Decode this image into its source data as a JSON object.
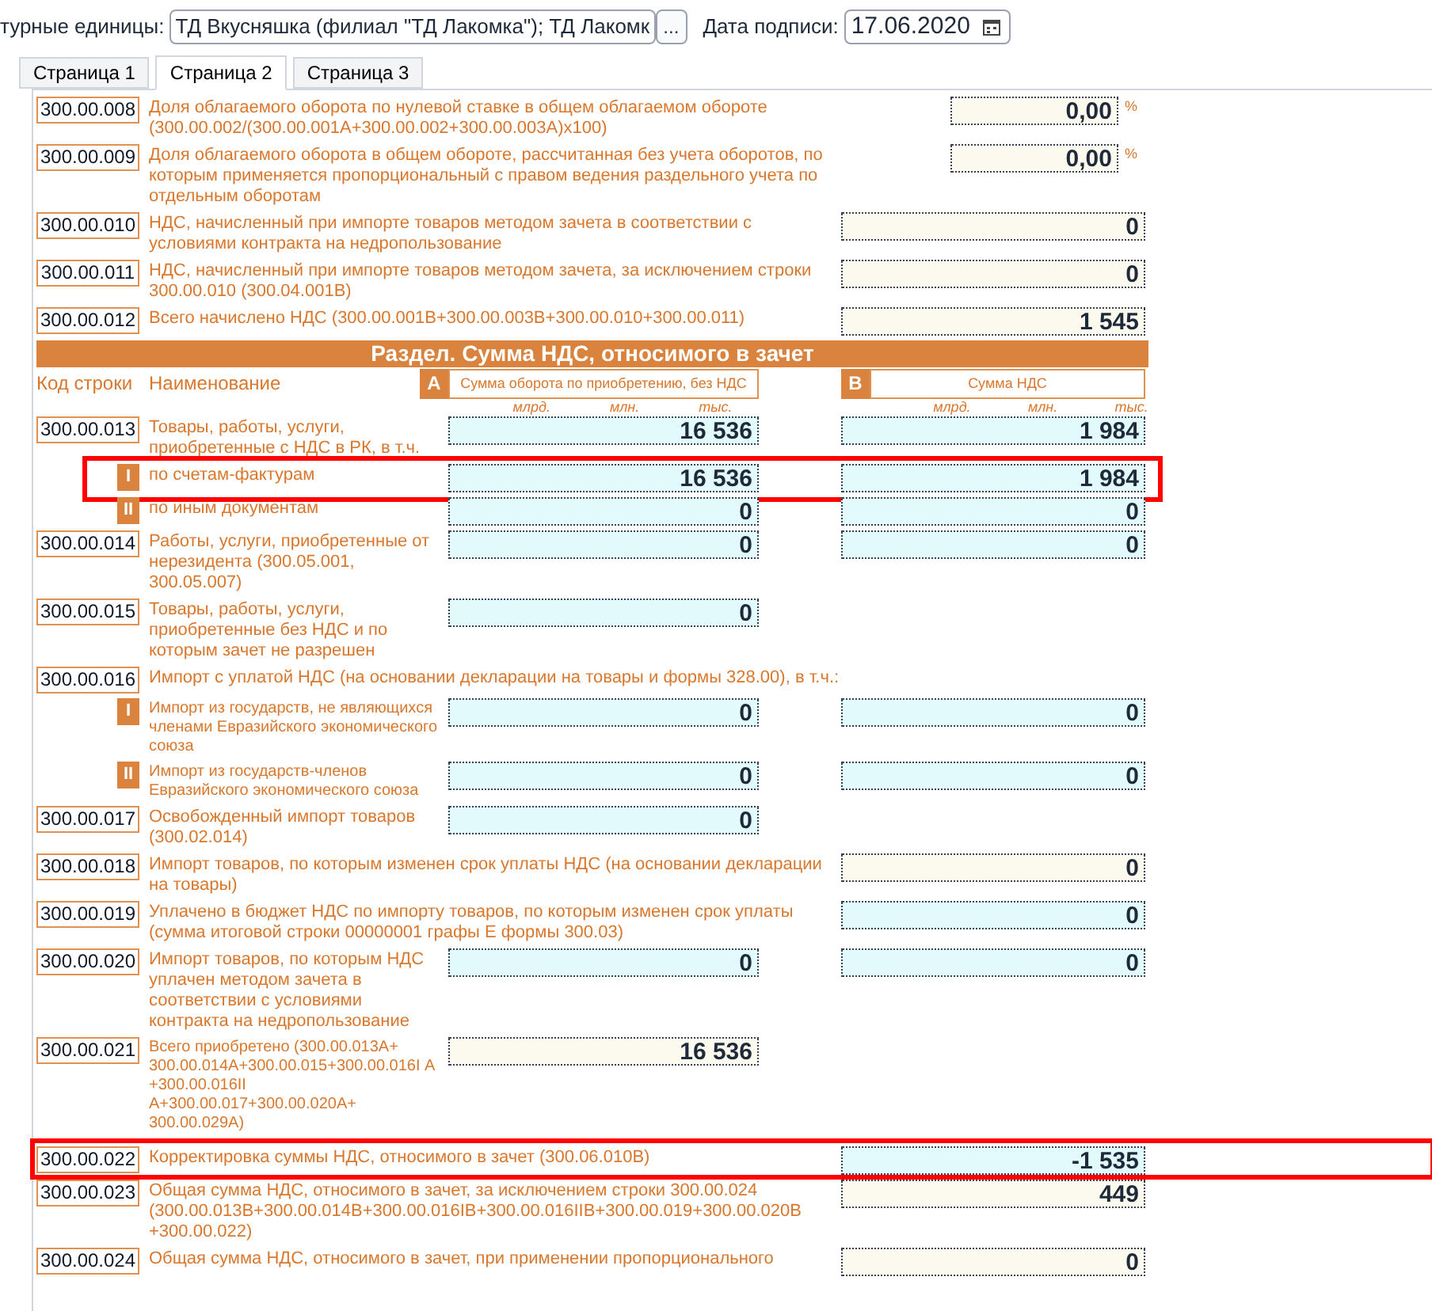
{
  "header": {
    "label": "турные единицы:",
    "value": "ТД Вкусняшка (филиал \"ТД Лакомка\"); ТД Лакомк",
    "more_button": "...",
    "date_label": "Дата подписи:",
    "date": "17.06.2020"
  },
  "tabs": [
    {
      "label": "Страница 1",
      "selected": false
    },
    {
      "label": "Страница 2",
      "selected": true
    },
    {
      "label": "Страница 3",
      "selected": false
    }
  ],
  "rows_top": [
    {
      "kind": "normal",
      "code": "300.00.008",
      "name": "Доля облагаемого оборота по нулевой ставке в общем облагаемом обороте (300.00.002/(300.00.001А+300.00.002+300.00.003А)х100)",
      "b": {
        "value": "0,00",
        "editable": false
      },
      "unit": "%",
      "highlighted": false
    },
    {
      "kind": "normal",
      "code": "300.00.009",
      "name": "Доля облагаемого оборота в общем обороте, рассчитанная без учета оборотов, по которым применяется пропорциональный с правом ведения раздельного учета по отдельным оборотам",
      "b": {
        "value": "0,00",
        "editable": false
      },
      "unit": "%",
      "highlighted": false
    },
    {
      "kind": "normal",
      "code": "300.00.010",
      "name": "НДС, начисленный при импорте товаров методом зачета в соответствии с условиями контракта на недропользование",
      "b": {
        "value": "0",
        "editable": false
      },
      "highlighted": false
    },
    {
      "kind": "normal",
      "code": "300.00.011",
      "name": "НДС, начисленный при импорте товаров методом зачета, за исключением строки 300.00.010 (300.04.001В)",
      "b": {
        "value": "0",
        "editable": false
      },
      "highlighted": false
    },
    {
      "kind": "normal",
      "code": "300.00.012",
      "name": "Всего начислено НДС (300.00.001В+300.00.003В+300.00.010+300.00.011)",
      "b": {
        "value": "1 545",
        "editable": false
      },
      "highlighted": false
    }
  ],
  "section": {
    "title": "Раздел. Сумма НДС, относимого в зачет",
    "code_heading": "Код строки",
    "name_heading": "Наименование",
    "column_a": {
      "letter": "A",
      "title": "Сумма оборота по приобретению, без НДС",
      "units": [
        "млрд.",
        "млн.",
        "тыс."
      ]
    },
    "column_b": {
      "letter": "B",
      "title": "Сумма НДС",
      "units": [
        "млрд.",
        "млн.",
        "тыс."
      ]
    }
  },
  "rows": [
    {
      "kind": "normal",
      "code": "300.00.013",
      "name": "Товары, работы, услуги, приобретенные с НДС в РК, в т.ч.",
      "a": {
        "value": "16 536",
        "editable": true
      },
      "b": {
        "value": "1 984",
        "editable": true
      },
      "highlighted": false
    },
    {
      "kind": "normal",
      "marker": "I",
      "name": "по счетам-фактурам",
      "a": {
        "value": "16 536",
        "editable": true
      },
      "b": {
        "value": "1 984",
        "editable": true
      },
      "highlighted": true
    },
    {
      "kind": "normal",
      "marker": "II",
      "name": "по иным документам",
      "a": {
        "value": "0",
        "editable": true
      },
      "b": {
        "value": "0",
        "editable": true
      },
      "highlighted": false
    },
    {
      "kind": "normal",
      "code": "300.00.014",
      "name": "Работы, услуги, приобретенные от нерезидента (300.05.001, 300.05.007)",
      "a": {
        "value": "0",
        "editable": true
      },
      "b": {
        "value": "0",
        "editable": true
      },
      "highlighted": false
    },
    {
      "kind": "normal",
      "code": "300.00.015",
      "name": "Товары, работы, услуги, приобретенные без НДС и по которым зачет не разрешен",
      "a": {
        "value": "0",
        "editable": true
      },
      "highlighted": false
    },
    {
      "kind": "normal",
      "code": "300.00.016",
      "name": "Импорт с уплатой НДС (на основании декларации на товары и формы 328.00), в т.ч.:",
      "highlighted": false
    },
    {
      "kind": "fine",
      "marker": "I",
      "name": "Импорт из государств, не являющихся членами Евразийского экономического союза",
      "a": {
        "value": "0",
        "editable": true
      },
      "b": {
        "value": "0",
        "editable": true
      },
      "highlighted": false
    },
    {
      "kind": "fine",
      "marker": "II",
      "name": "Импорт из государств-членов Евразийского экономического союза",
      "a": {
        "value": "0",
        "editable": true
      },
      "b": {
        "value": "0",
        "editable": true
      },
      "highlighted": false
    },
    {
      "kind": "normal",
      "code": "300.00.017",
      "name": "Освобожденный импорт товаров (300.02.014)",
      "a": {
        "value": "0",
        "editable": true
      },
      "highlighted": false
    },
    {
      "kind": "normal",
      "code": "300.00.018",
      "name": "Импорт товаров, по которым изменен срок уплаты НДС (на основании декларации на товары)",
      "b": {
        "value": "0",
        "editable": false
      },
      "highlighted": false
    },
    {
      "kind": "normal",
      "code": "300.00.019",
      "name": "Уплачено в бюджет НДС по импорту товаров, по которым изменен срок уплаты (сумма итоговой строки 00000001 графы Е формы 300.03)",
      "b": {
        "value": "0",
        "editable": true
      },
      "highlighted": false
    },
    {
      "kind": "normal",
      "code": "300.00.020",
      "name": "Импорт товаров, по которым НДС уплачен методом зачета в соответствии с условиями контракта на недропользование",
      "a": {
        "value": "0",
        "editable": true
      },
      "b": {
        "value": "0",
        "editable": true
      },
      "highlighted": false
    },
    {
      "kind": "fine",
      "code": "300.00.021",
      "name": "Всего приобретено (300.00.013А+ 300.00.014А+300.00.015+300.00.016I А +300.00.016II А+300.00.017+300.00.020А+ 300.00.029А)",
      "a": {
        "value": "16 536",
        "editable": false
      },
      "highlighted": false
    },
    {
      "kind": "normal",
      "code": "300.00.022",
      "name": "Корректировка суммы НДС, относимого в зачет (300.06.010В)",
      "b": {
        "value": "-1 535",
        "editable": true
      },
      "highlighted": true
    },
    {
      "kind": "normal",
      "code": "300.00.023",
      "name": "Общая сумма НДС, относимого в зачет, за исключением строки 300.00.024 (300.00.013В+300.00.014В+300.00.016IВ+300.00.016IIВ+300.00.019+300.00.020В +300.00.022)",
      "b": {
        "value": "449",
        "editable": false
      },
      "highlighted": false
    },
    {
      "kind": "normal",
      "code": "300.00.024",
      "name": "Общая сумма НДС, относимого в зачет, при применении пропорционального",
      "b": {
        "value": "0",
        "editable": false
      },
      "highlighted": false
    }
  ]
}
